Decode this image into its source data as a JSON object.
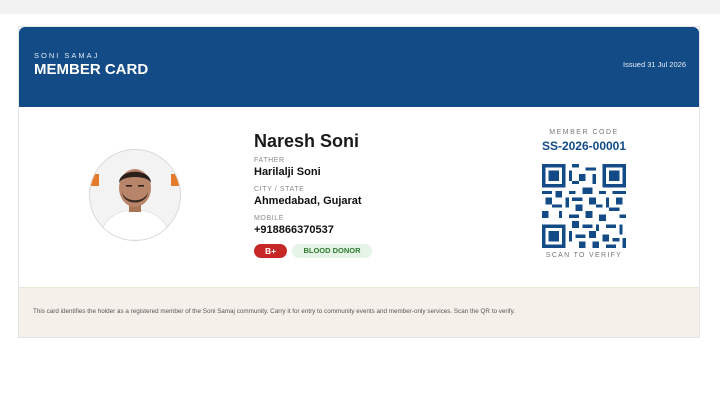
{
  "header": {
    "org": "SONI SAMAJ",
    "title": "MEMBER CARD",
    "issued": "Issued 31 Jul 2026"
  },
  "member": {
    "name": "Naresh Soni",
    "father_label": "FATHER",
    "father": "Harilalji Soni",
    "city_label": "CITY / STATE",
    "city": "Ahmedabad, Gujarat",
    "mobile_label": "MOBILE",
    "mobile": "+918866370537",
    "blood_group": "B+",
    "donor_badge": "BLOOD DONOR"
  },
  "verification": {
    "code_label": "MEMBER CODE",
    "code": "SS-2026-00001",
    "scan_label": "SCAN TO VERIFY",
    "qr_icon": "qr-code-icon"
  },
  "footer": {
    "text": "This card identifies the holder as a registered member of the Soni Samaj community. Carry it for entry to community events and member-only services. Scan the QR to verify."
  },
  "colors": {
    "header_bg": "#134b86",
    "blood_badge": "#c62828",
    "donor_badge_bg": "#e5f4e6",
    "donor_badge_text": "#2e7d32",
    "footer_bg": "#f5f1ea"
  }
}
